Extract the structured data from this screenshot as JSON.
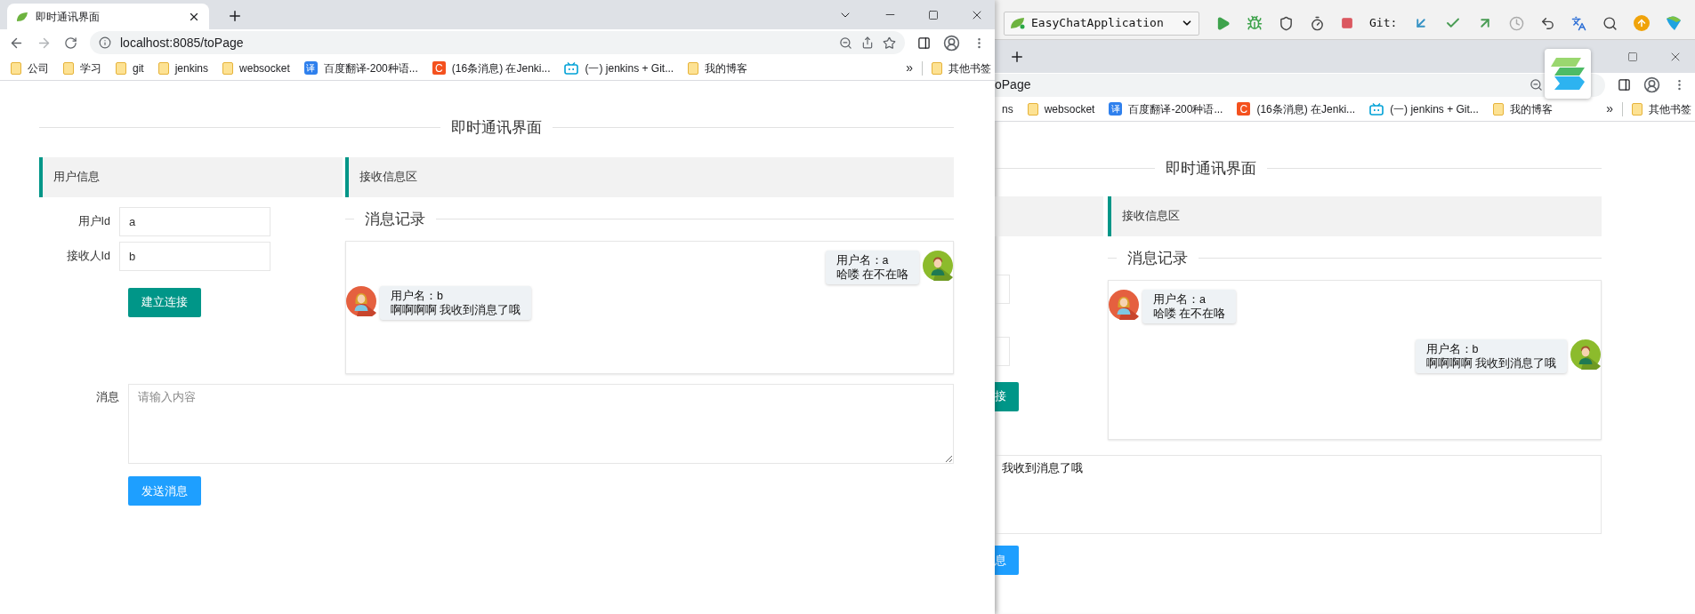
{
  "left_window": {
    "tab_title": "即时通讯界面",
    "address": "localhost:8085/toPage",
    "bookmarks": [
      {
        "kind": "folder",
        "label": "公司"
      },
      {
        "kind": "folder",
        "label": "学习"
      },
      {
        "kind": "folder",
        "label": "git"
      },
      {
        "kind": "folder",
        "label": "jenkins"
      },
      {
        "kind": "folder",
        "label": "websocket"
      },
      {
        "kind": "translate",
        "icon_text": "译",
        "label": "百度翻译-200种语..."
      },
      {
        "kind": "csdn",
        "icon_text": "C",
        "label": "(16条消息) 在Jenki..."
      },
      {
        "kind": "tv",
        "label": "(一) jenkins + Git..."
      },
      {
        "kind": "folder",
        "label": "我的博客"
      }
    ],
    "more": "»",
    "other_bookmarks": "其他书签",
    "page": {
      "title": "即时通讯界面",
      "user_panel_title": "用户信息",
      "fields": [
        {
          "label": "用户Id",
          "value": "a"
        },
        {
          "label": "接收人Id",
          "value": "b"
        }
      ],
      "connect_button": "建立连接",
      "receive_panel_title": "接收信息区",
      "history_title": "消息记录",
      "messages": [
        {
          "kind": "right",
          "username": "用户名：a",
          "text": "哈喽 在不在咯"
        },
        {
          "kind": "left",
          "username": "用户名：b",
          "text": "啊啊啊啊 我收到消息了哦"
        }
      ],
      "message_label": "消息",
      "message_placeholder": "请输入内容",
      "send_button": "发送消息"
    }
  },
  "ide_toolbar": {
    "run_config": "EasyChatApplication",
    "git_label": "Git:"
  },
  "right_window": {
    "address": "oPage",
    "bookmarks": [
      {
        "label": "ns"
      },
      {
        "kind": "folder",
        "label": "websocket"
      },
      {
        "kind": "translate",
        "icon_text": "译",
        "label": "百度翻译-200种语..."
      },
      {
        "kind": "csdn",
        "icon_text": "C",
        "label": "(16条消息) 在Jenki..."
      },
      {
        "kind": "tv",
        "label": "(一) jenkins + Git..."
      },
      {
        "kind": "folder",
        "label": "我的博客"
      }
    ],
    "more": "»",
    "other_bookmarks": "其他书签",
    "page": {
      "title": "即时通讯界面",
      "receive_panel_title": "接收信息区",
      "history_title": "消息记录",
      "messages": [
        {
          "kind": "left",
          "username": "用户名：a",
          "text": "哈喽 在不在咯"
        },
        {
          "kind": "right",
          "username": "用户名：b",
          "text": "啊啊啊啊 我收到消息了哦"
        }
      ],
      "connect_button": "接",
      "message_value": "我收到消息了哦",
      "send_button": "息"
    }
  }
}
